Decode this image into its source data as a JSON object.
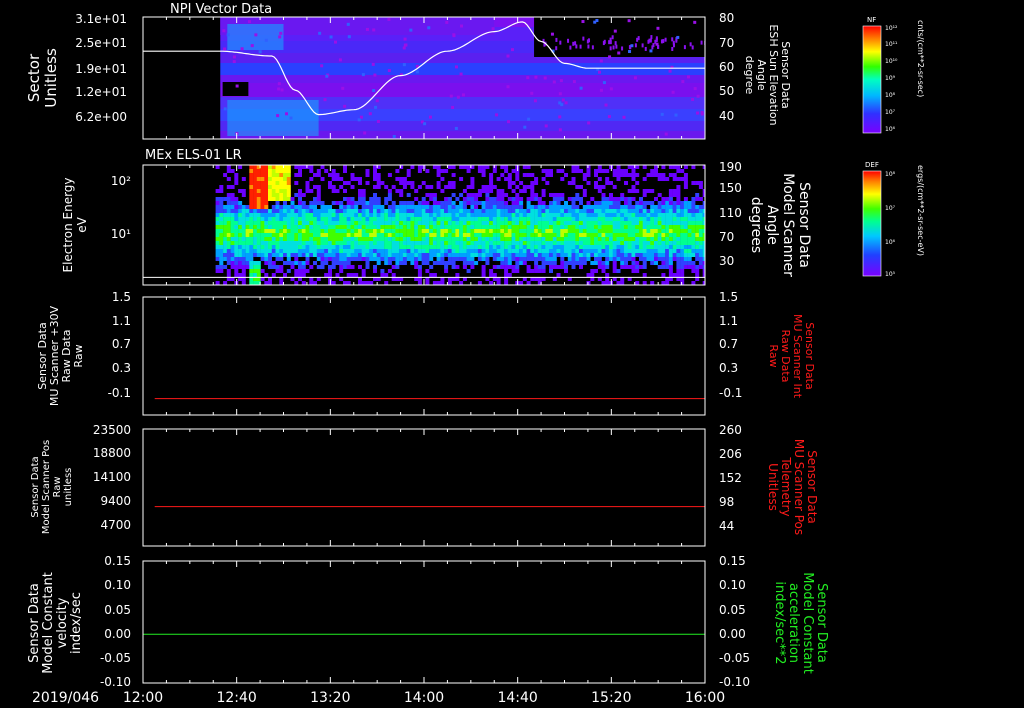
{
  "date_label": "2019/046",
  "time_ticks": [
    "12:00",
    "12:40",
    "13:20",
    "14:00",
    "14:40",
    "15:20",
    "16:00"
  ],
  "time_range_min": [
    0,
    240
  ],
  "colors": {
    "white": "#ffffff",
    "red": "#ff1a1a",
    "green": "#22ee22",
    "bg": "#000000"
  },
  "panels": [
    {
      "title": "NPI Vector Data",
      "left_label": [
        "Sector",
        "Unitless"
      ],
      "left_ticks": [
        "3.1e+01",
        "2.5e+01",
        "1.9e+01",
        "1.2e+01",
        "6.2e+00"
      ],
      "right_label": [
        "Sensor Data",
        "ESH Sun Elevation",
        "Angle",
        "degree"
      ],
      "right_ticks": [
        "80",
        "70",
        "60",
        "50",
        "40"
      ],
      "colorbar": {
        "tag": "NF",
        "ticks": [
          "10¹²",
          "10¹¹",
          "10¹⁰",
          "10⁹",
          "10⁸",
          "10⁷",
          "10⁶"
        ],
        "units": "cnts/(cm**2-sr-sec)"
      }
    },
    {
      "title": "MEx ELS-01 LR",
      "left_label": [
        "Electron Energy",
        "eV"
      ],
      "left_ticks": [
        "10²",
        "10¹"
      ],
      "right_label": [
        "Sensor Data",
        "Model Scanner",
        "Angle",
        "degrees"
      ],
      "right_ticks": [
        "190",
        "150",
        "110",
        "70",
        "30"
      ],
      "colorbar": {
        "tag": "DEF",
        "ticks": [
          "10⁸",
          "10⁷",
          "10⁶",
          "10⁵"
        ],
        "units": "ergs/(cm**2-sr-sec-eV)"
      }
    },
    {
      "title": "",
      "left_label": [
        "Sensor Data",
        "MU Scanner +30V",
        "Raw Data",
        "Raw"
      ],
      "left_ticks": [
        "1.5",
        "1.1",
        "0.7",
        "0.3",
        "-0.1"
      ],
      "right_label": [
        "Sensor Data",
        "MU Scanner Int",
        "Raw Data",
        "Raw"
      ],
      "right_ticks": [
        "1.5",
        "1.1",
        "0.7",
        "0.3",
        "-0.1"
      ]
    },
    {
      "title": "",
      "left_label": [
        "Sensor Data",
        "Model Scanner Pos",
        "Raw",
        "unitless"
      ],
      "left_ticks": [
        "23500",
        "18800",
        "14100",
        "9400",
        "4700"
      ],
      "right_label": [
        "Sensor Data",
        "MU Scanner Pos",
        "Telemetry",
        "Unitless"
      ],
      "right_ticks": [
        "260",
        "206",
        "152",
        "98",
        "44"
      ]
    },
    {
      "title": "",
      "left_label": [
        "Sensor Data",
        "Model Constant",
        "velocity",
        "index/sec"
      ],
      "left_ticks": [
        "0.15",
        "0.10",
        "0.05",
        "0.00",
        "-0.05",
        "-0.10"
      ],
      "right_label": [
        "Sensor Data",
        "Model Constant",
        "acceleration",
        "index/sec**2"
      ],
      "right_ticks": [
        "0.15",
        "0.10",
        "0.05",
        "0.00",
        "-0.05",
        "-0.10"
      ]
    }
  ],
  "chart_data": [
    {
      "type": "heatmap",
      "title": "NPI Vector Data",
      "xlabel": "",
      "ylabel": "Sector Unitless",
      "x_range_min": [
        0,
        240
      ],
      "y_ticks": [
        31,
        25,
        19,
        12,
        6.2
      ],
      "data_start_min": 33,
      "overlay_series": {
        "name": "Sensor Data ESH Sun Elevation Angle",
        "axis": "right",
        "ylim": [
          30,
          80
        ],
        "x_min": [
          0,
          33,
          55,
          65,
          75,
          90,
          110,
          130,
          150,
          162,
          170,
          180,
          190,
          240
        ],
        "y": [
          66,
          66,
          64,
          50,
          40,
          42,
          56,
          66,
          74,
          78,
          70,
          61,
          59,
          59
        ]
      }
    },
    {
      "type": "heatmap",
      "title": "MEx ELS-01 LR",
      "ylabel": "Electron Energy eV",
      "y_scale": "log",
      "ylim": [
        1.5,
        150
      ],
      "data_start_min": 31,
      "overlay_series": {
        "name": "Sensor Data Model Scanner Angle",
        "axis": "right",
        "ylim": [
          0,
          190
        ],
        "x_min": [
          0,
          240
        ],
        "y": [
          12,
          12
        ]
      }
    },
    {
      "type": "line",
      "ylabel": "Sensor Data MU Scanner +30V Raw Data Raw",
      "ylim": [
        -0.3,
        1.5
      ],
      "series": [
        {
          "name": "Sensor Data MU Scanner Int Raw Data Raw",
          "color": "red",
          "x_min": [
            5,
            240
          ],
          "y": [
            -0.05,
            -0.05
          ]
        }
      ]
    },
    {
      "type": "line",
      "ylabel": "Sensor Data Model Scanner Pos Raw unitless",
      "ylim": [
        0,
        23500
      ],
      "series": [
        {
          "name": "Sensor Data MU Scanner Pos Telemetry Unitless",
          "color": "red",
          "x_min": [
            5,
            240
          ],
          "y": [
            7900,
            7900
          ]
        }
      ]
    },
    {
      "type": "line",
      "ylabel": "Sensor Data Model Constant velocity index/sec",
      "ylim": [
        -0.1,
        0.15
      ],
      "series": [
        {
          "name": "Sensor Data Model Constant acceleration index/sec**2",
          "color": "green",
          "x_min": [
            0,
            240
          ],
          "y": [
            0,
            0
          ]
        }
      ]
    }
  ]
}
